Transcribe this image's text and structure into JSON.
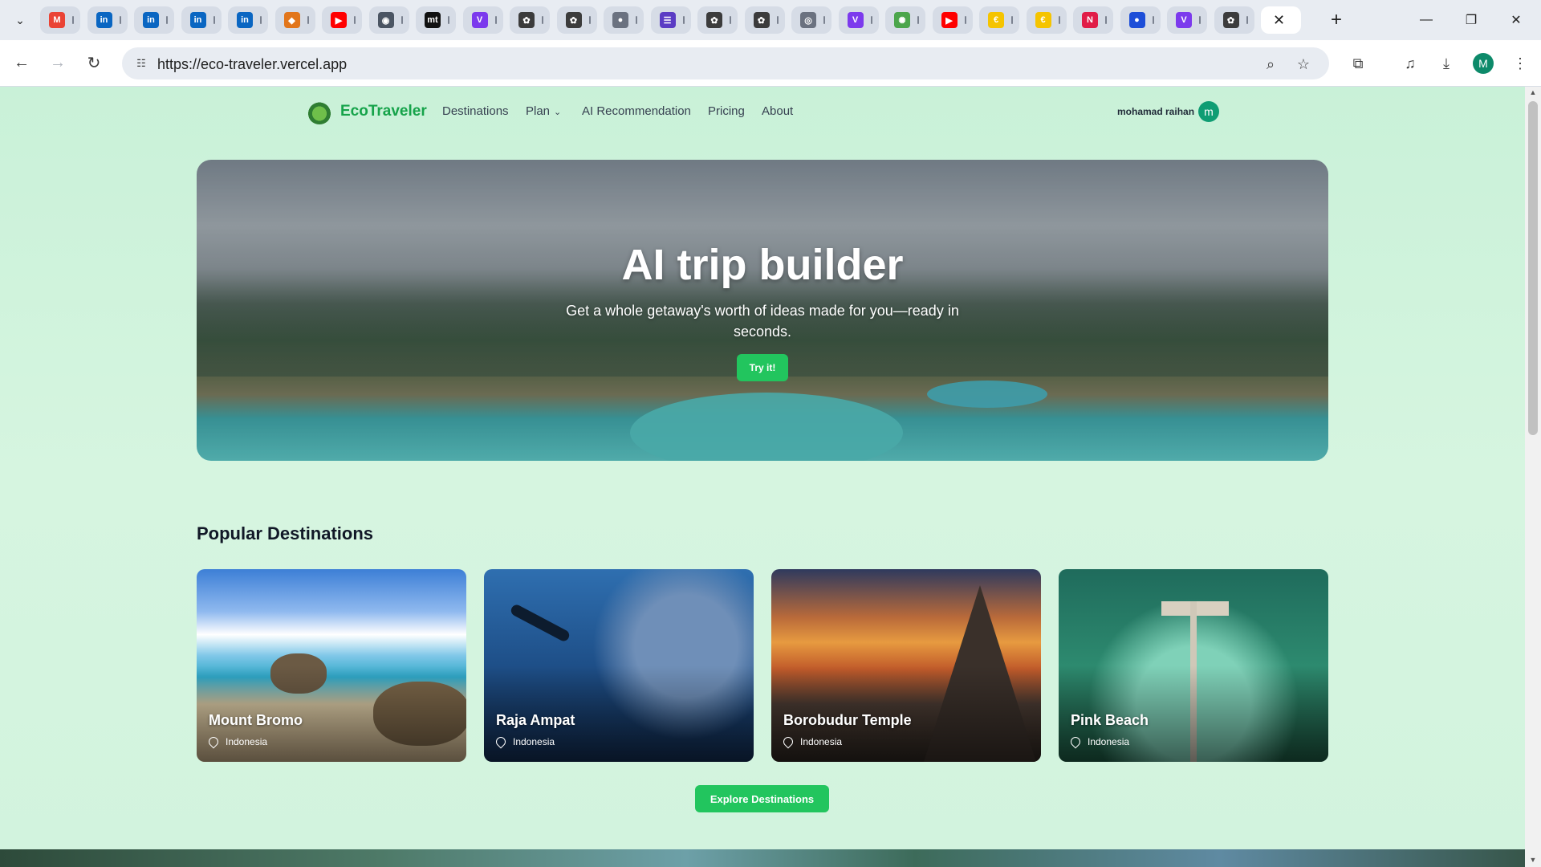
{
  "browser": {
    "tabs": [
      {
        "icon": "gmail-icon",
        "glyph": "M",
        "color": "#ea4335"
      },
      {
        "icon": "linkedin-icon",
        "glyph": "in",
        "color": "#0a66c2"
      },
      {
        "icon": "linkedin-icon",
        "glyph": "in",
        "color": "#0a66c2"
      },
      {
        "icon": "linkedin-icon",
        "glyph": "in",
        "color": "#0a66c2"
      },
      {
        "icon": "linkedin-icon",
        "glyph": "in",
        "color": "#0a66c2"
      },
      {
        "icon": "metamask-icon",
        "glyph": "◆",
        "color": "#e2761b"
      },
      {
        "icon": "youtube-icon",
        "glyph": "▶",
        "color": "#ff0000"
      },
      {
        "icon": "cat-icon",
        "glyph": "◉",
        "color": "#4b5563"
      },
      {
        "icon": "mt-icon",
        "glyph": "mt",
        "color": "#111111"
      },
      {
        "icon": "v-icon",
        "glyph": "V",
        "color": "#7c3aed"
      },
      {
        "icon": "openai-icon",
        "glyph": "✿",
        "color": "#3c3c3c"
      },
      {
        "icon": "openai-icon",
        "glyph": "✿",
        "color": "#3c3c3c"
      },
      {
        "icon": "circle-icon",
        "glyph": "●",
        "color": "#6b7280"
      },
      {
        "icon": "list-icon",
        "glyph": "☰",
        "color": "#5b3cc4"
      },
      {
        "icon": "openai-icon",
        "glyph": "✿",
        "color": "#3c3c3c"
      },
      {
        "icon": "openai-icon",
        "glyph": "✿",
        "color": "#3c3c3c"
      },
      {
        "icon": "spiral-icon",
        "glyph": "◎",
        "color": "#6b7280"
      },
      {
        "icon": "v-icon",
        "glyph": "V",
        "color": "#7c3aed"
      },
      {
        "icon": "brain-icon",
        "glyph": "✺",
        "color": "#4ca64c"
      },
      {
        "icon": "youtube-icon",
        "glyph": "▶",
        "color": "#ff0000"
      },
      {
        "icon": "coin-icon",
        "glyph": "€",
        "color": "#f5c400"
      },
      {
        "icon": "coin-icon",
        "glyph": "€",
        "color": "#f5c400"
      },
      {
        "icon": "n-icon",
        "glyph": "N",
        "color": "#e11d48"
      },
      {
        "icon": "globe-icon",
        "glyph": "●",
        "color": "#1d4ed8"
      },
      {
        "icon": "v-icon",
        "glyph": "V",
        "color": "#7c3aed"
      },
      {
        "icon": "openai-icon",
        "glyph": "✿",
        "color": "#3c3c3c"
      }
    ],
    "active_tab_close": "✕",
    "new_tab": "+",
    "url": "https://eco-traveler.vercel.app",
    "profile_initial": "M"
  },
  "site": {
    "brand": "EcoTraveler",
    "nav": {
      "destinations": "Destinations",
      "plan": "Plan",
      "ai_recommendation": "AI Recommendation",
      "pricing": "Pricing",
      "about": "About"
    },
    "user": {
      "name": "mohamad raihan",
      "initial": "m"
    },
    "hero": {
      "title": "AI trip builder",
      "subtitle": "Get a whole getaway's worth of ideas made for you—ready in seconds.",
      "cta": "Try it!"
    },
    "popular": {
      "title": "Popular Destinations",
      "cards": [
        {
          "name": "Mount Bromo",
          "location": "Indonesia"
        },
        {
          "name": "Raja Ampat",
          "location": "Indonesia"
        },
        {
          "name": "Borobudur Temple",
          "location": "Indonesia"
        },
        {
          "name": "Pink Beach",
          "location": "Indonesia"
        }
      ],
      "explore": "Explore Destinations"
    }
  }
}
